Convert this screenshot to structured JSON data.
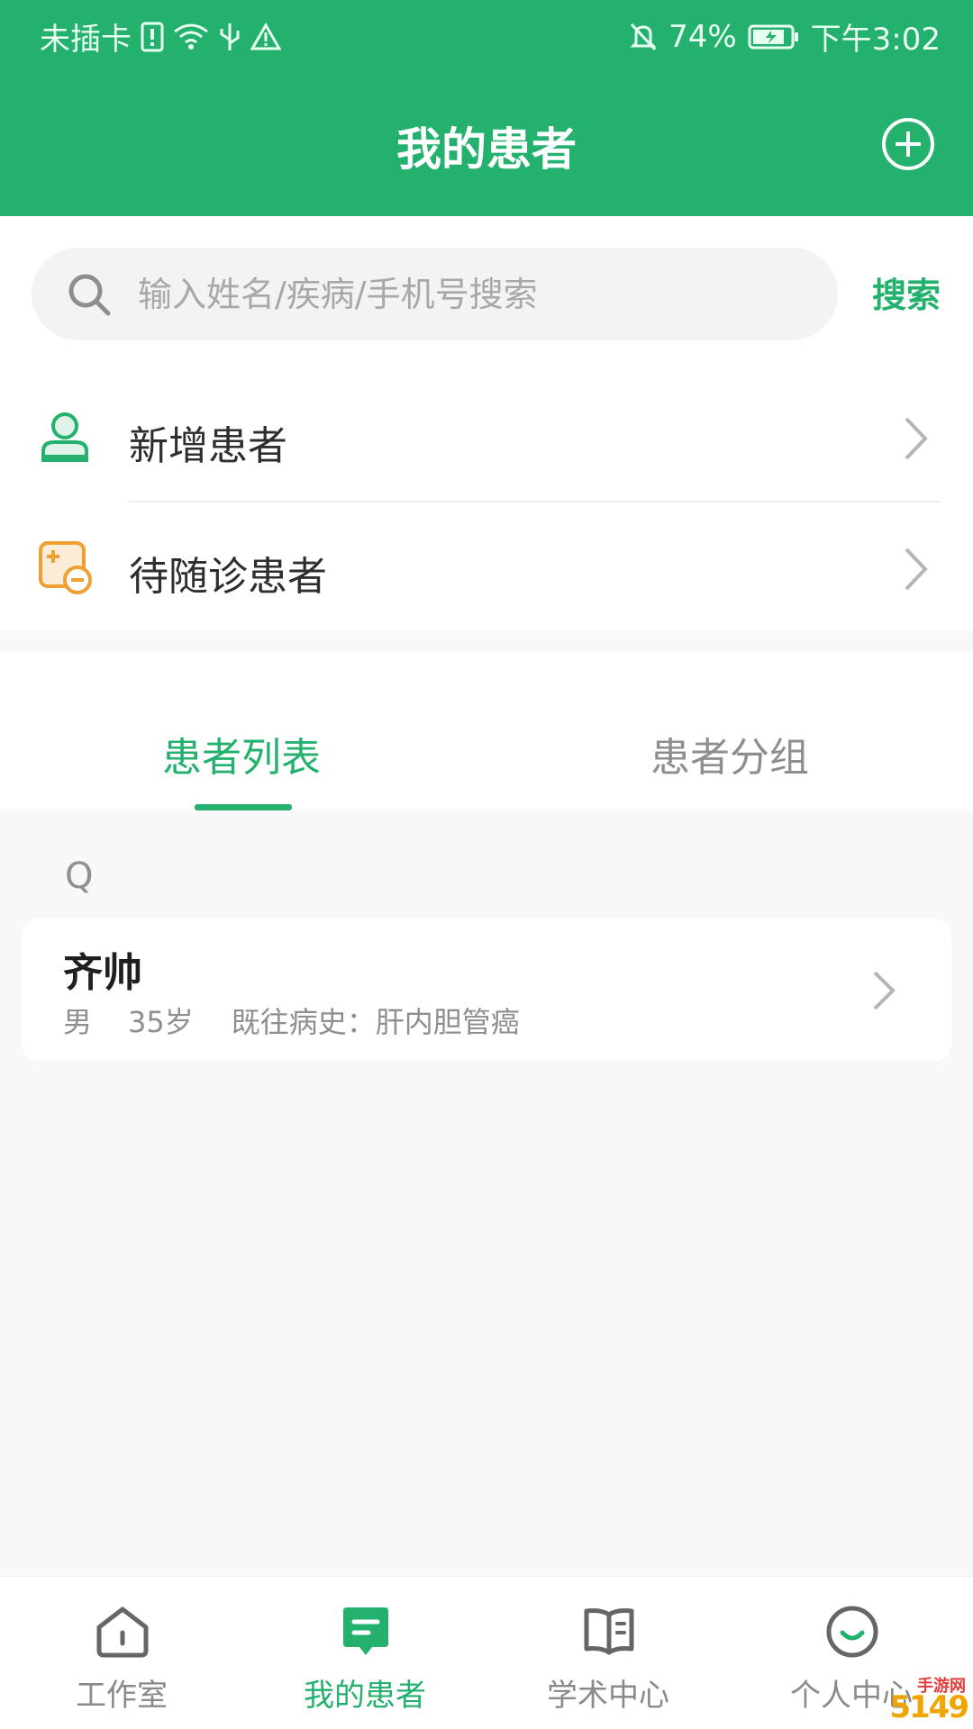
{
  "status_bar": {
    "carrier": "未插卡",
    "battery": "74%",
    "time": "下午3:02"
  },
  "header": {
    "title": "我的患者"
  },
  "search": {
    "placeholder": "输入姓名/疾病/手机号搜索",
    "button_label": "搜索"
  },
  "menu": {
    "items": [
      {
        "label": "新增患者",
        "icon": "add-patient-icon"
      },
      {
        "label": "待随诊患者",
        "icon": "pending-followup-icon"
      }
    ]
  },
  "tabs": [
    {
      "label": "患者列表",
      "active": true
    },
    {
      "label": "患者分组",
      "active": false
    }
  ],
  "patient_list": {
    "section_letter": "Q",
    "patients": [
      {
        "name": "齐帅",
        "gender": "男",
        "age": "35岁",
        "history": "既往病史：肝内胆管癌"
      }
    ]
  },
  "bottom_nav": [
    {
      "label": "工作室",
      "icon": "home-icon",
      "active": false
    },
    {
      "label": "我的患者",
      "icon": "message-icon",
      "active": true
    },
    {
      "label": "学术中心",
      "icon": "book-icon",
      "active": false
    },
    {
      "label": "个人中心",
      "icon": "smile-icon",
      "active": false
    }
  ],
  "watermark": {
    "text": "5149",
    "sub": "手游网"
  },
  "colors": {
    "brand": "#23b16d",
    "warning_orange": "#f0a030"
  }
}
